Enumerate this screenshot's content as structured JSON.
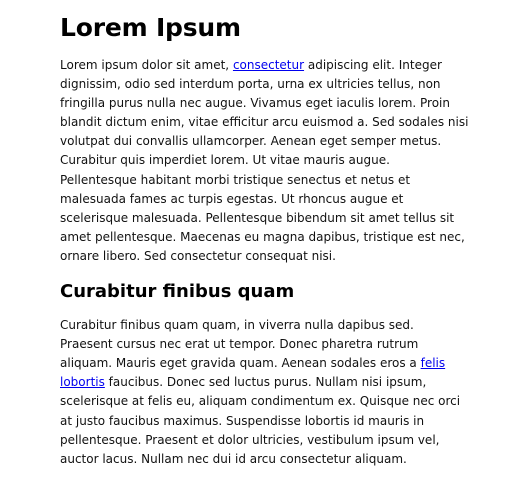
{
  "article": {
    "title": "Lorem Ipsum",
    "p1": {
      "before": "Lorem ipsum dolor sit amet, ",
      "link": "consectetur",
      "after": " adipiscing elit. Integer dignissim, odio sed interdum porta, urna ex ultricies tellus, non fringilla purus nulla nec augue. Vivamus eget iaculis lorem. Proin blandit dictum enim, vitae efficitur arcu euismod a. Sed sodales nisi volutpat dui convallis ullamcorper. Aenean eget semper metus. Curabitur quis imperdiet lorem. Ut vitae mauris augue. Pellentesque habitant morbi tristique senectus et netus et malesuada fames ac turpis egestas. Ut rhoncus augue et scelerisque malesuada. Pellentesque bibendum sit amet tellus sit amet pellentesque. Maecenas eu magna dapibus, tristique est nec, ornare libero. Sed consectetur consequat nisi."
    },
    "subtitle": "Curabitur finibus quam",
    "p2": {
      "before": "Curabitur finibus quam quam, in viverra nulla dapibus sed. Praesent cursus nec erat ut tempor. Donec pharetra rutrum aliquam. Mauris eget gravida quam. Aenean sodales eros a ",
      "link": "felis lobortis",
      "after": " faucibus. Donec sed luctus purus. Nullam nisi ipsum, scelerisque at felis eu, aliquam condimentum ex. Quisque nec orci at justo faucibus maximus. Suspendisse lobortis id mauris in pellentesque. Praesent et dolor ultricies, vestibulum ipsum vel, auctor lacus. Nullam nec dui id arcu consectetur aliquam."
    }
  }
}
